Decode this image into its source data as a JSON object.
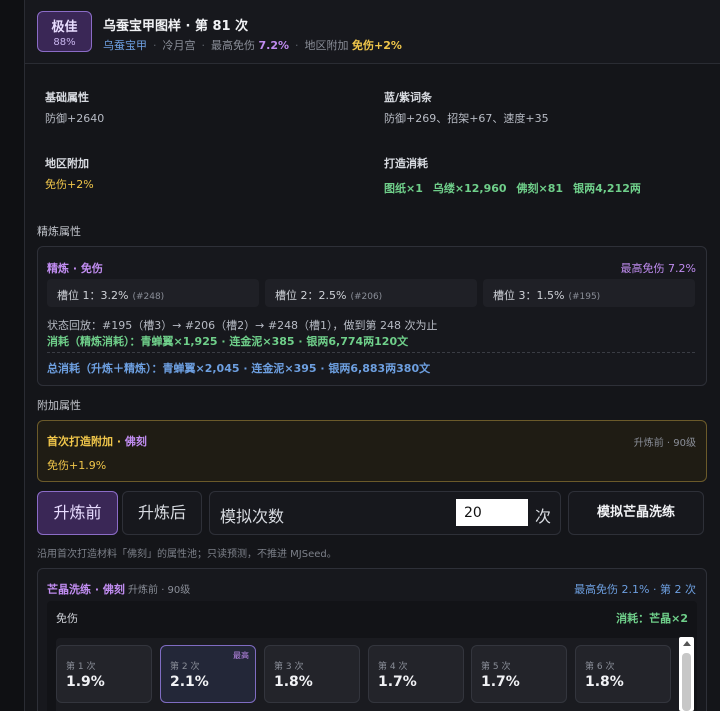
{
  "header": {
    "grade_label": "极佳",
    "grade_pct": "88%",
    "title": "乌蚕宝甲图样 · 第 81 次",
    "item": "乌蚕宝甲",
    "sect": "冷月宫",
    "max_label": "最高免伤",
    "max_value": "7.2%",
    "region_label": "地区附加",
    "region_value": "免伤+2%"
  },
  "info": {
    "base_label": "基础属性",
    "base_value": "防御+2640",
    "bluepurple_label": "蓝/紫词条",
    "bluepurple_value": "防御+269、招架+67、速度+35",
    "region_label": "地区附加",
    "region_value": "免伤+2%",
    "cost_label": "打造消耗",
    "costs": [
      "图纸×1",
      "乌缕×12,960",
      "佛刻×81",
      "银两4,212两"
    ]
  },
  "refine": {
    "section_title": "精炼属性",
    "title": "精炼 · 免伤",
    "max": "最高免伤 7.2%",
    "slots": [
      {
        "label": "槽位 1：3.2%",
        "tag": "(#248)"
      },
      {
        "label": "槽位 2：2.5%",
        "tag": "(#206)"
      },
      {
        "label": "槽位 3：1.5%",
        "tag": "(#195)"
      }
    ],
    "replay": "状态回放：#195（槽3）→ #206（槽2）→ #248（槽1），做到第 248 次为止",
    "cost": "消耗（精炼消耗）：青蝉翼×1,925 · 连金泥×385 · 银两6,774两120文",
    "total": "总消耗（升炼＋精炼）：青蝉翼×2,045 · 连金泥×395 · 银两6,883两380文"
  },
  "extra": {
    "section_title": "附加属性",
    "title_a": "首次打造附加 · ",
    "title_b": "佛刻",
    "right": "升炼前 · 90级",
    "value": "免伤+1.9%"
  },
  "controls": {
    "tab_before": "升炼前",
    "tab_after": "升炼后",
    "sim_label": "模拟次数",
    "sim_value": "20",
    "sim_unit": "次",
    "sim_button": "模拟芒晶洗练",
    "note": "沿用首次打造材料「佛刻」的属性池；只读预测，不推进 MJSeed。"
  },
  "result": {
    "title": "芒晶洗练 · 佛刻",
    "title_muted": " 升炼前 · 90级",
    "right": "最高免伤 2.1% · 第 2 次",
    "attr": "免伤",
    "consume": "消耗：芒晶×2",
    "best_tag": "最高",
    "tries": [
      {
        "label": "第 1 次",
        "value": "1.9%"
      },
      {
        "label": "第 2 次",
        "value": "2.1%"
      },
      {
        "label": "第 3 次",
        "value": "1.8%"
      },
      {
        "label": "第 4 次",
        "value": "1.7%"
      },
      {
        "label": "第 5 次",
        "value": "1.7%"
      },
      {
        "label": "第 6 次",
        "value": "1.8%"
      }
    ]
  }
}
